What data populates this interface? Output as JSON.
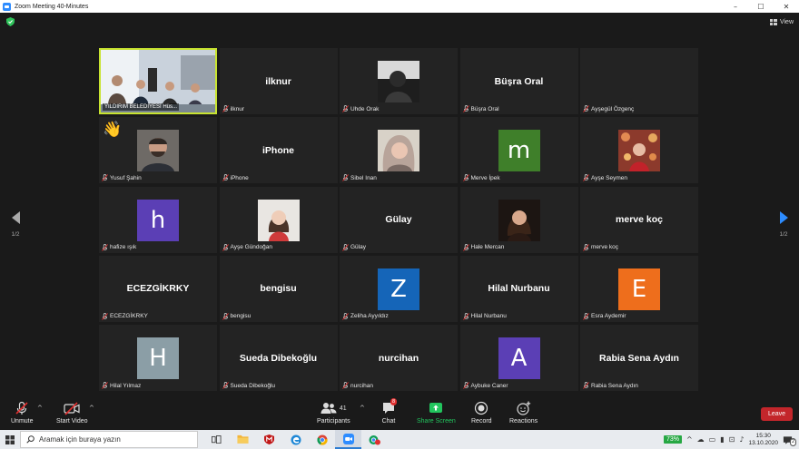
{
  "window": {
    "title": "Zoom Meeting 40-Minutes",
    "controls": [
      "–",
      "☐",
      "✕"
    ]
  },
  "top": {
    "view_label": "View"
  },
  "pager": {
    "left_page": "1/2",
    "right_page": "1/2"
  },
  "tiles": [
    {
      "kind": "video",
      "name": "YILDIRIM BELEDİYESİ Hüs...",
      "active": true
    },
    {
      "kind": "name",
      "name": "ilknur"
    },
    {
      "kind": "photo",
      "name": "Uhde Orak",
      "photo": "photo-uhde"
    },
    {
      "kind": "name",
      "name": "Büşra Oral"
    },
    {
      "kind": "name",
      "name": "Ayşegül Özgenç",
      "centered": false
    },
    {
      "kind": "photo",
      "name": "Yusuf Şahin",
      "photo": "photo-yusuf",
      "reaction": "👋"
    },
    {
      "kind": "name",
      "name": "iPhone"
    },
    {
      "kind": "photo",
      "name": "Sibel Inan",
      "photo": "photo-sibel"
    },
    {
      "kind": "letter",
      "name": "Merve İpek",
      "letter": "m",
      "color": "#3f7f2a"
    },
    {
      "kind": "photo",
      "name": "Ayşe Seymen",
      "photo": "photo-ayse-s"
    },
    {
      "kind": "letter",
      "name": "hafize ışık",
      "letter": "h",
      "color": "#5b3fb5"
    },
    {
      "kind": "photo",
      "name": "Ayşe Gündoğan",
      "photo": "photo-ayse-g"
    },
    {
      "kind": "name",
      "name": "Gülay"
    },
    {
      "kind": "photo",
      "name": "Hale Mercan",
      "photo": "photo-hale"
    },
    {
      "kind": "name",
      "name": "merve koç"
    },
    {
      "kind": "name",
      "name": "ECEZGİKRKY"
    },
    {
      "kind": "name",
      "name": "bengisu"
    },
    {
      "kind": "letter",
      "name": "Zeliha Ayyıldız",
      "letter": "Z",
      "color": "#1565b8"
    },
    {
      "kind": "name",
      "name": "Hilal Nurbanu"
    },
    {
      "kind": "letter",
      "name": "Esra Aydemir",
      "letter": "E",
      "color": "#ee6e1c"
    },
    {
      "kind": "letter",
      "name": "Hilal Yılmaz",
      "letter": "H",
      "color": "#8b9ea6"
    },
    {
      "kind": "name",
      "name": "Sueda Dibekoğlu"
    },
    {
      "kind": "name",
      "name": "nurcihan"
    },
    {
      "kind": "letter",
      "name": "Aybuke Caner",
      "letter": "A",
      "color": "#5b3fb5"
    },
    {
      "kind": "name",
      "name": "Rabia Sena Aydın"
    }
  ],
  "toolbar": {
    "unmute": "Unmute",
    "start_video": "Start Video",
    "participants": "Participants",
    "participants_count": "41",
    "chat": "Chat",
    "chat_badge": "8",
    "share_screen": "Share Screen",
    "record": "Record",
    "reactions": "Reactions",
    "leave": "Leave",
    "caret": "^"
  },
  "taskbar": {
    "search_placeholder": "Aramak için buraya yazın",
    "battery": "73%",
    "time": "15:30",
    "date": "13.10.2020",
    "notification_count": "2"
  },
  "colors": {
    "accent": "#2d8cff",
    "active_border": "#c8e330",
    "leave": "#c3262b",
    "share": "#22c55e"
  }
}
